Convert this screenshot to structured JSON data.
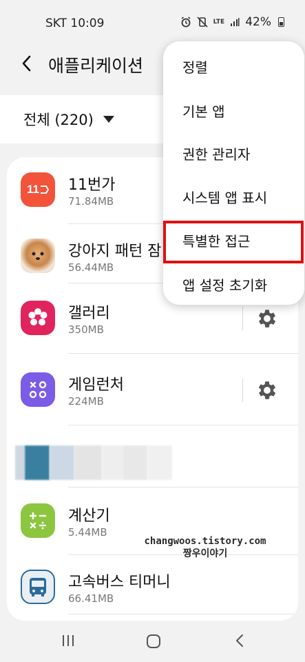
{
  "status_bar": {
    "carrier_time": "SKT 10:09",
    "network": "LTE",
    "battery": "42%"
  },
  "header": {
    "title": "애플리케이션"
  },
  "filter": {
    "label": "전체 (220)"
  },
  "apps": [
    {
      "name": "11번가",
      "size": "71.84MB",
      "icon": "11st-icon",
      "icon_text": "11"
    },
    {
      "name": "강아지 패턴 잠",
      "size": "56.44MB",
      "icon": "puppy-photo-icon"
    },
    {
      "name": "갤러리",
      "size": "350MB",
      "icon": "gallery-flower-icon"
    },
    {
      "name": "게임런처",
      "size": "224MB",
      "icon": "game-launcher-icon"
    },
    {
      "name": "계산기",
      "size": "5.44MB",
      "icon": "calculator-icon"
    },
    {
      "name": "고속버스 티머니",
      "size": "66.41MB",
      "icon": "bus-icon"
    }
  ],
  "menu": {
    "items": [
      "정렬",
      "기본 앱",
      "권한 관리자",
      "시스템 앱 표시",
      "특별한 접근",
      "앱 설정 초기화"
    ],
    "highlighted": "특별한 접근"
  },
  "watermark": {
    "line1": "changwoos.tistory.com",
    "line2": "짱우이야기"
  },
  "colors": {
    "highlight": "#e01010",
    "app_11st": "#f2533a",
    "gallery": "#e0245e",
    "game_launcher": "#7b5ce6",
    "calculator": "#8cc63f",
    "bus": "#2a6a9a"
  }
}
